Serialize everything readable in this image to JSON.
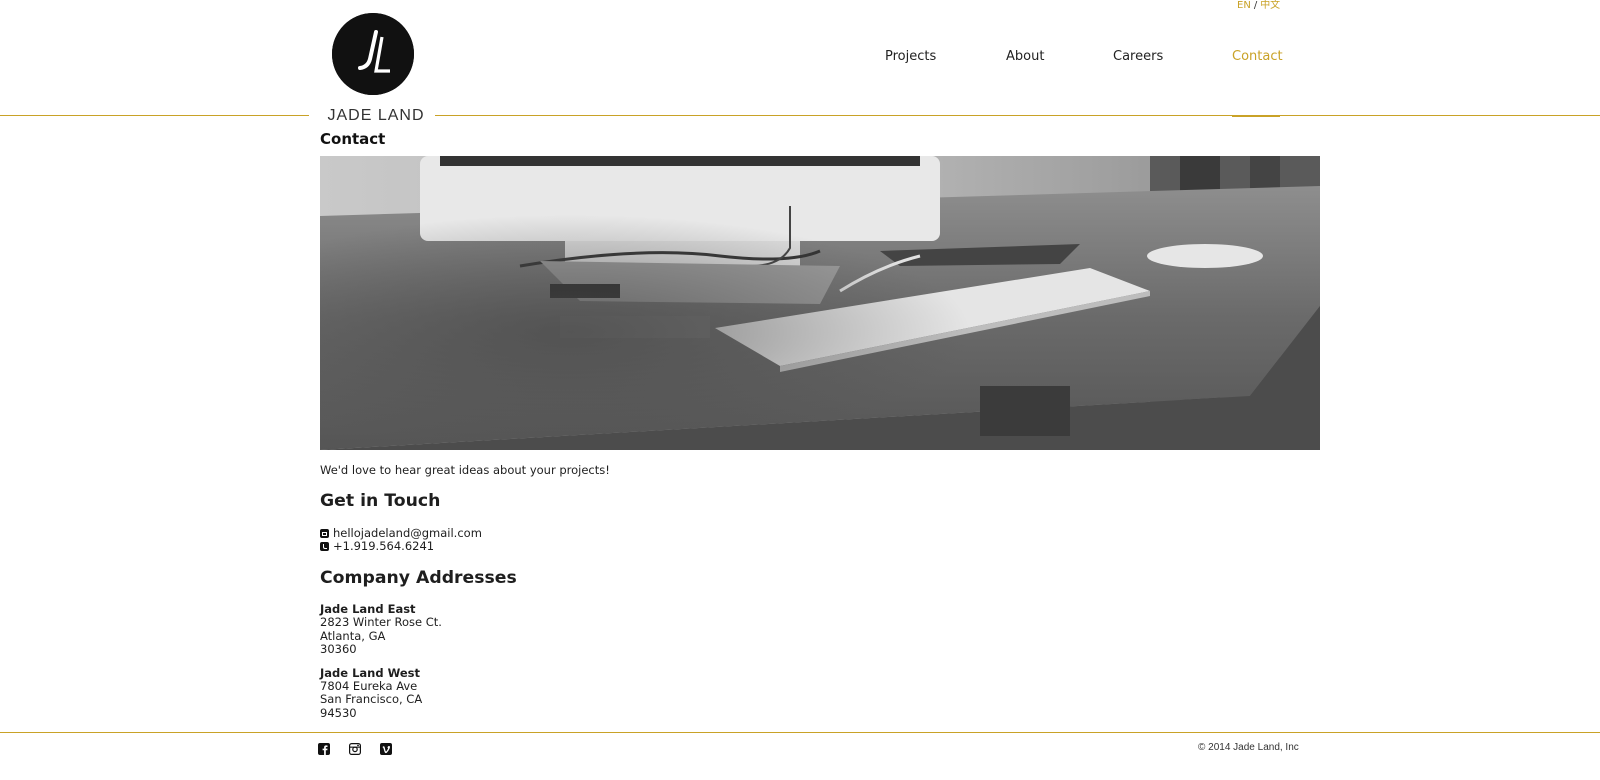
{
  "language_switch": {
    "en": "EN",
    "separator": "/",
    "zh": "中文"
  },
  "brand": {
    "name": "JADE LAND",
    "logo_icon": "jl-monogram-icon"
  },
  "nav": [
    {
      "label": "Projects",
      "active": false
    },
    {
      "label": "About",
      "active": false
    },
    {
      "label": "Careers",
      "active": false
    },
    {
      "label": "Contact",
      "active": true
    }
  ],
  "colors": {
    "accent": "#c9a227",
    "text": "#1e1e1e",
    "logo_bg": "#111111"
  },
  "page": {
    "title": "Contact"
  },
  "hero": {
    "icon": "desk-photo-image"
  },
  "content": {
    "intro": "We'd love to hear great ideas about your projects!",
    "get_in_touch_heading": "Get in Touch",
    "email": "hellojadeland@gmail.com",
    "phone": "+1.919.564.6241",
    "addresses_heading": "Company Addresses",
    "offices": [
      {
        "name": "Jade Land East",
        "street": "2823 Winter Rose Ct.",
        "city": "Atlanta, GA",
        "zip": "30360"
      },
      {
        "name": "Jade Land West",
        "street": "7804 Eureka Ave",
        "city": "San Francisco, CA",
        "zip": "94530"
      }
    ]
  },
  "footer": {
    "social": [
      "facebook-icon",
      "instagram-icon",
      "vimeo-icon"
    ],
    "copyright": "© 2014 Jade Land, Inc"
  }
}
